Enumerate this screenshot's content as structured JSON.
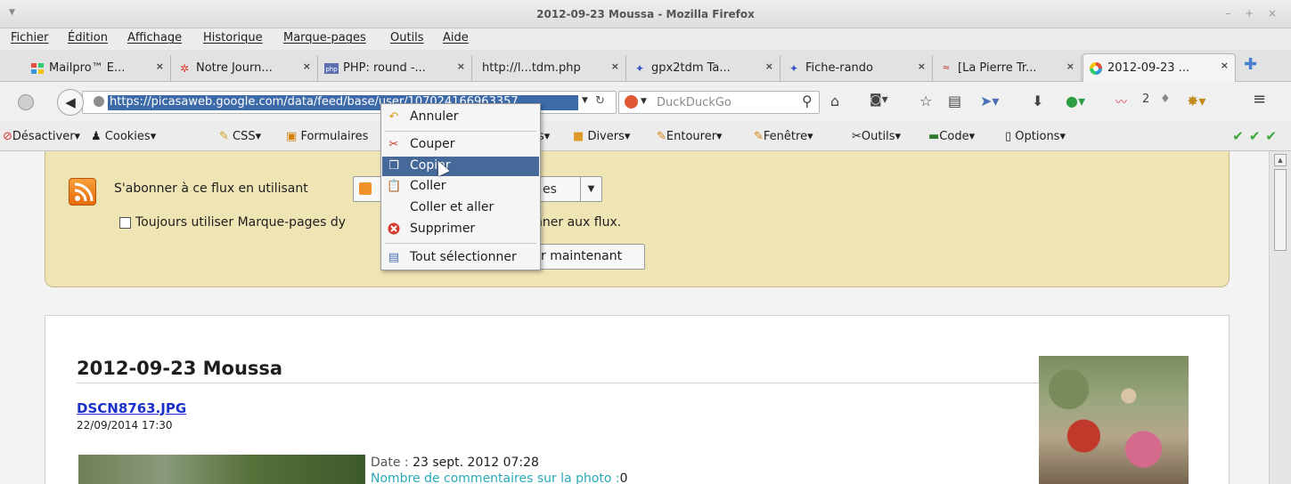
{
  "window": {
    "title": "2012-09-23 Moussa - Mozilla Firefox"
  },
  "menu": [
    "Fichier",
    "Édition",
    "Affichage",
    "Historique",
    "Marque-pages",
    "Outils",
    "Aide"
  ],
  "tabs": [
    {
      "label": "Mailpro™ E...",
      "icon": "mailpro-icon",
      "close": "×"
    },
    {
      "label": "Notre Journ...",
      "icon": "journal-icon",
      "close": "×"
    },
    {
      "label": "PHP: round -...",
      "icon": "php-icon",
      "close": "×"
    },
    {
      "label": "http://l...tdm.php",
      "icon": "",
      "close": "×"
    },
    {
      "label": "gpx2tdm Ta...",
      "icon": "hiker-icon",
      "close": "×"
    },
    {
      "label": "Fiche-rando",
      "icon": "hiker-icon",
      "close": "×"
    },
    {
      "label": "[La Pierre Tr...",
      "icon": "site-icon",
      "close": "×"
    },
    {
      "label": "2012-09-23 ...",
      "icon": "picasa-icon",
      "close": "×"
    }
  ],
  "navbar": {
    "url": "https://picasaweb.google.com/data/feed/base/user/107024166963357",
    "search_placeholder": "DuckDuckGo",
    "badge_count": "2"
  },
  "toolbar": [
    "Désactiver▾",
    "Cookies▾",
    "CSS▾",
    "Formulaires",
    "s▾",
    "Divers▾",
    "Entourer▾",
    "Fenêtre▾",
    "Outils▾",
    "Code▾",
    "Options▾"
  ],
  "feed": {
    "subscribe_text": "S'abonner à ce flux en utilisant",
    "select_label": "es",
    "checkbox_label": "Toujours utiliser Marque-pages dy",
    "checkbox_rest": "nner aux flux.",
    "subscribe_button": "r maintenant",
    "title": "2012-09-23 Moussa",
    "entry_link": "DSCN8763.JPG",
    "entry_date": "22/09/2014 17:30",
    "date_label": "Date : ",
    "date_value": "23 sept. 2012 07:28",
    "comments_label": "Nombre de commentaires sur la photo :",
    "comments_value": "0"
  },
  "context_menu": {
    "items": [
      "Annuler",
      "Couper",
      "Copier",
      "Coller",
      "Coller et aller",
      "Supprimer",
      "Tout sélectionner"
    ]
  }
}
